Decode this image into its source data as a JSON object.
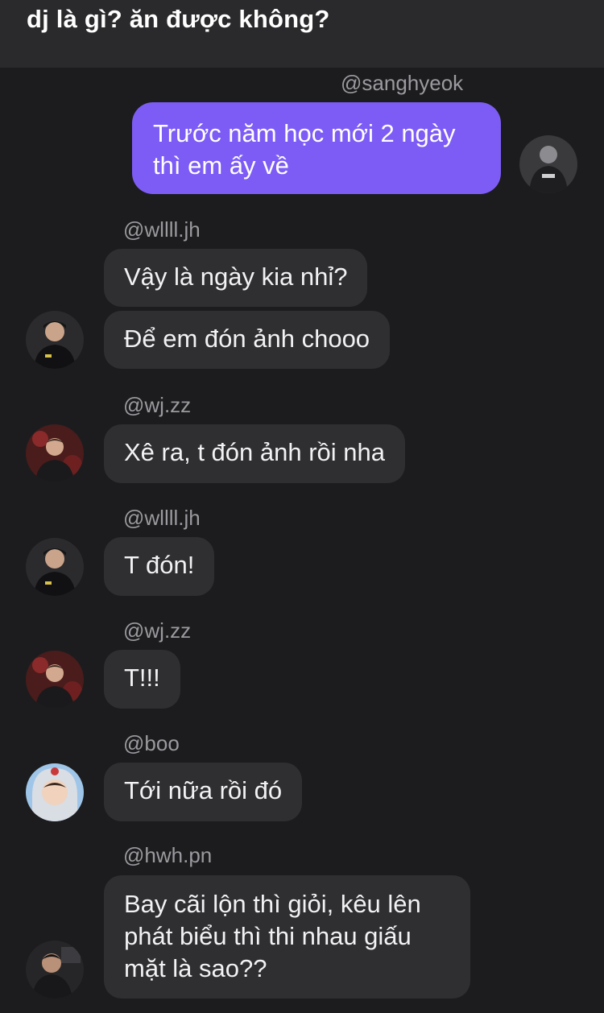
{
  "thread": {
    "title": "dj là gì? ăn được không?"
  },
  "messages": [
    {
      "sender": "@sanghyeok",
      "text": "Trước năm học mới 2 ngày thì em ấy về",
      "avatar_icon": "user-avatar-icon"
    },
    {
      "sender": "@wllll.jh",
      "text": "Vậy là ngày kia nhỉ?",
      "avatar_icon": "user-avatar-icon"
    },
    {
      "text": "Để em đón ảnh chooo"
    },
    {
      "sender": "@wj.zz",
      "text": "Xê ra, t đón ảnh rồi nha",
      "avatar_icon": "user-avatar-icon"
    },
    {
      "sender": "@wllll.jh",
      "text": "T đón!",
      "avatar_icon": "user-avatar-icon"
    },
    {
      "sender": "@wj.zz",
      "text": "T!!!",
      "avatar_icon": "user-avatar-icon"
    },
    {
      "sender": "@boo",
      "text": "Tới nữa rồi đó",
      "avatar_icon": "user-avatar-icon"
    },
    {
      "sender": "@hwh.pn",
      "text": "Bay cãi lộn thì giỏi, kêu lên phát biểu thì thi nhau giấu mặt là sao??",
      "avatar_icon": "user-avatar-icon"
    }
  ],
  "colors": {
    "background": "#1c1c1e",
    "header": "#2a2a2c",
    "own_bubble": "#7d5cf6",
    "other_bubble": "#2f2f31",
    "sender_text": "#9a9a9f"
  }
}
